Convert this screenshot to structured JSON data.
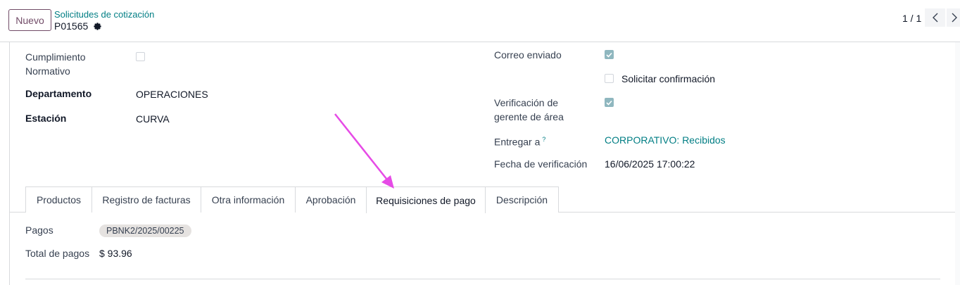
{
  "control_panel": {
    "new_button": "Nuevo",
    "breadcrumb": "Solicitudes de cotización",
    "record_name": "P01565",
    "pager": "1 / 1"
  },
  "left_fields": {
    "cumplimiento_label_line1": "Cumplimiento",
    "cumplimiento_label_line2": "Normativo",
    "cumplimiento_checked": false,
    "departamento_label": "Departamento",
    "departamento_value": "OPERACIONES",
    "estacion_label": "Estación",
    "estacion_value": "CURVA"
  },
  "right_fields": {
    "correo_label": "Correo enviado",
    "correo_checked": true,
    "solicitar_label": "Solicitar confirmación",
    "solicitar_checked": false,
    "verificacion_label_line1": "Verificación de",
    "verificacion_label_line2": "gerente de área",
    "verificacion_checked": true,
    "entregar_label": "Entregar a",
    "entregar_help": "?",
    "entregar_value": "CORPORATIVO: Recibidos",
    "fecha_label": "Fecha de verificación",
    "fecha_value": "16/06/2025 17:00:22"
  },
  "tabs": [
    {
      "label": "Productos"
    },
    {
      "label": "Registro de facturas"
    },
    {
      "label": "Otra información"
    },
    {
      "label": "Aprobación"
    },
    {
      "label": "Requisiciones de pago",
      "active": true
    },
    {
      "label": "Descripción"
    }
  ],
  "payments": {
    "pagos_label": "Pagos",
    "pagos_tag": "PBNK2/2025/00225",
    "total_label": "Total de pagos",
    "total_value": "$ 93.96"
  },
  "colors": {
    "brand": "#714b67",
    "link": "#017e84",
    "arrow": "#e64be6",
    "checkbox_on": "#8fb7bf"
  }
}
